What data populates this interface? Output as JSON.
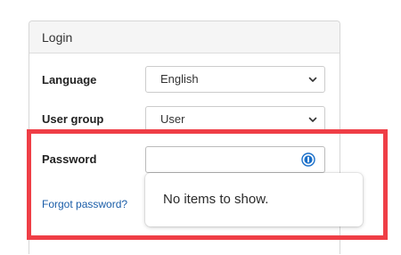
{
  "panel": {
    "title": "Login"
  },
  "form": {
    "language": {
      "label": "Language",
      "selected": "English"
    },
    "user_group": {
      "label": "User group",
      "selected": "User"
    },
    "password": {
      "label": "Password",
      "value": ""
    },
    "forgot_link": "Forgot password?"
  },
  "autofill_dropdown": {
    "empty_message": "No items to show."
  },
  "icons": {
    "select_arrow": "chevron-down-icon",
    "password_manager": "password-manager-icon"
  },
  "colors": {
    "highlight": "#ef3e46",
    "link": "#1a5da8",
    "password_icon": "#1a6fc9"
  }
}
